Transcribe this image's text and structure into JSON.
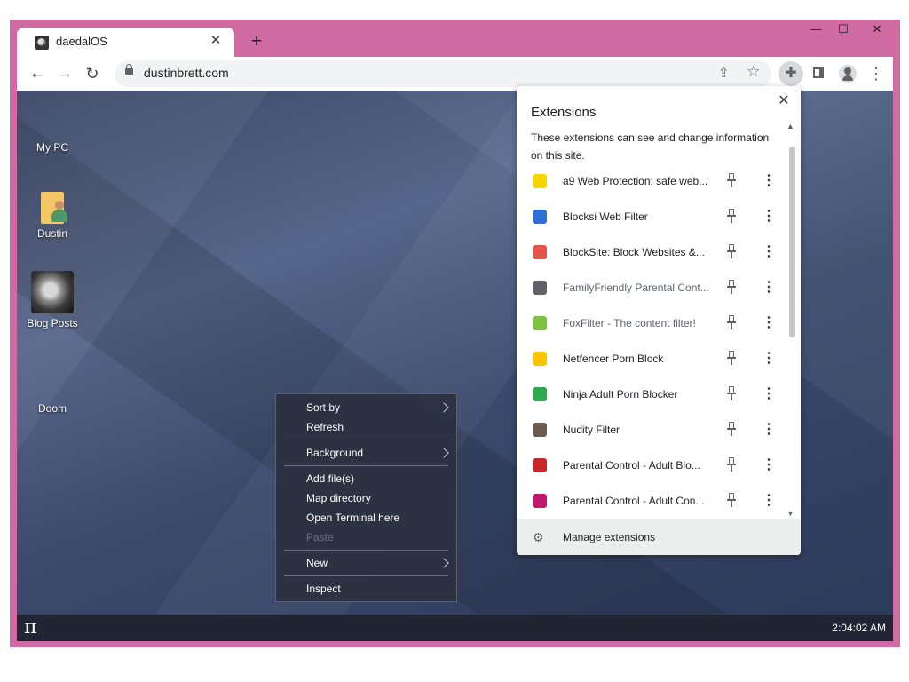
{
  "browser": {
    "tab_title": "daedalOS",
    "new_tab_glyph": "+",
    "tab_close_glyph": "✕",
    "url": "dustinbrett.com",
    "window_controls": {
      "minimize": "—",
      "maximize": "☐",
      "close": "✕"
    }
  },
  "desktop": {
    "icons": [
      {
        "label": "My PC",
        "icon": "computer-icon"
      },
      {
        "label": "Dustin",
        "icon": "user-folder-icon"
      },
      {
        "label": "Blog Posts",
        "icon": "brain-scan-icon"
      },
      {
        "label": "Doom",
        "icon": "doom-icon"
      }
    ],
    "taskbar": {
      "start_glyph": "π",
      "clock": "2:04:02 AM"
    }
  },
  "context_menu": {
    "items": [
      {
        "label": "Sort by",
        "submenu": true
      },
      {
        "label": "Refresh"
      },
      {
        "label": "Background",
        "submenu": true
      },
      {
        "label": "Add file(s)"
      },
      {
        "label": "Map directory"
      },
      {
        "label": "Open Terminal here"
      },
      {
        "label": "Paste",
        "disabled": true
      },
      {
        "label": "New",
        "submenu": true
      },
      {
        "label": "Inspect"
      }
    ]
  },
  "extensions": {
    "title": "Extensions",
    "description": "These extensions can see and change information on this site.",
    "close_glyph": "✕",
    "items": [
      {
        "name": "a9 Web Protection: safe web...",
        "icon_color": "#f5d600",
        "dim": false
      },
      {
        "name": "Blocksi Web Filter",
        "icon_color": "#2f6fd6",
        "dim": false
      },
      {
        "name": "BlockSite: Block Websites &...",
        "icon_color": "#e2574c",
        "dim": false
      },
      {
        "name": "FamilyFriendly Parental Cont...",
        "icon_color": "#5f6368",
        "dim": true
      },
      {
        "name": "FoxFilter - The content filter!",
        "icon_color": "#7cc242",
        "dim": true
      },
      {
        "name": "Netfencer Porn Block",
        "icon_color": "#f7c600",
        "dim": false
      },
      {
        "name": "Ninja Adult Porn Blocker",
        "icon_color": "#2fa84f",
        "dim": false
      },
      {
        "name": "Nudity Filter",
        "icon_color": "#6b5a4e",
        "dim": false
      },
      {
        "name": "Parental Control - Adult Blo...",
        "icon_color": "#c62828",
        "dim": false
      },
      {
        "name": "Parental Control - Adult Con...",
        "icon_color": "#c2186b",
        "dim": false
      }
    ],
    "manage_label": "Manage extensions"
  }
}
